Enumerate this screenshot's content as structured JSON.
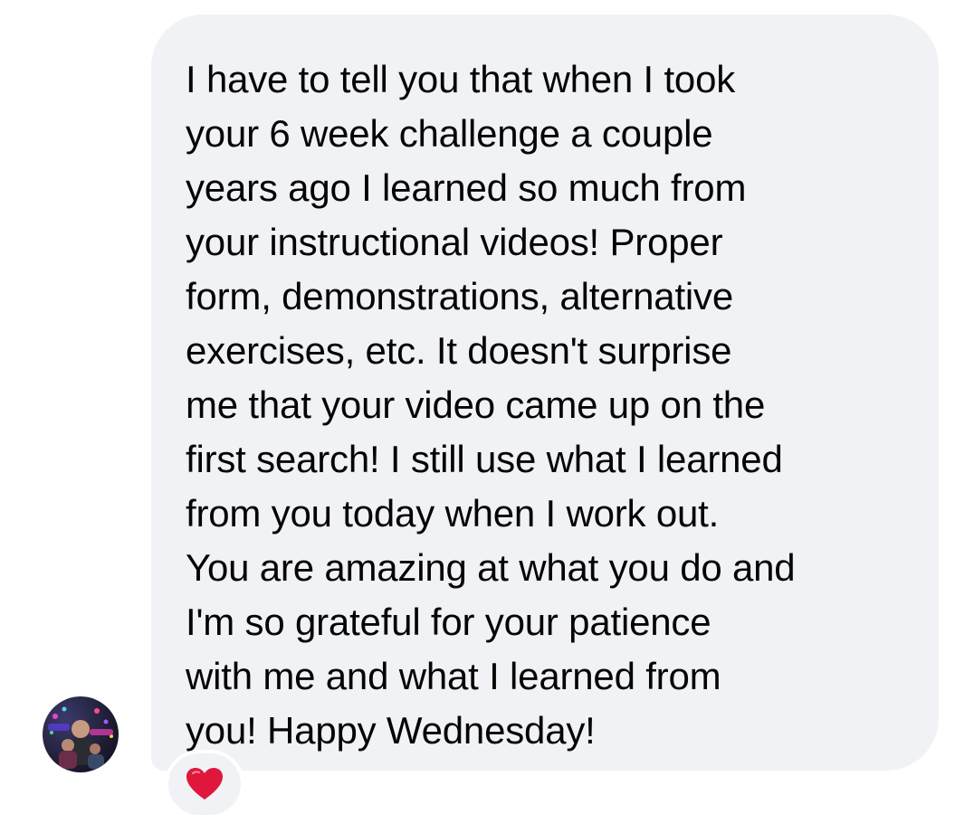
{
  "message": {
    "lines": [
      "I have to tell you that when I took",
      "your 6 week challenge a couple",
      "years ago I learned so much from",
      "your instructional videos! Proper",
      "form, demonstrations, alternative",
      "exercises, etc. It doesn't surprise",
      "me that your video came up on the",
      "first search! I still use what I learned",
      "from you today when I work out.",
      "You are amazing at what you do and",
      "I'm so grateful for your patience",
      "with me and what I learned from",
      "you! Happy Wednesday!"
    ]
  },
  "sender": {
    "avatar_icon": "profile-photo"
  },
  "reaction": {
    "icon": "heart-icon",
    "color": "#e0173c"
  },
  "colors": {
    "bubble": "#f1f2f5",
    "text": "#050505",
    "background": "#ffffff"
  }
}
